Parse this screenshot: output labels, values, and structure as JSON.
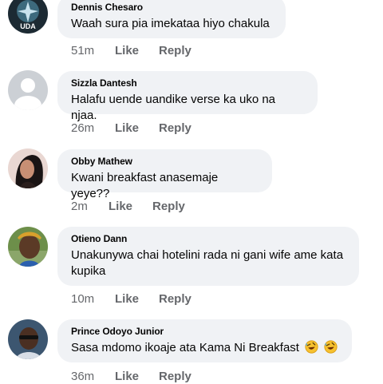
{
  "comments": [
    {
      "name": "Dennis Chesaro",
      "text": "Waah sura pia imekataa hiyo chakula",
      "time": "51m",
      "like": "Like",
      "reply": "Reply",
      "avatar_badge": "UDA"
    },
    {
      "name": "Sizzla Dantesh",
      "text": "Halafu uende uandike verse ka uko na njaa.",
      "time": "26m",
      "like": "Like",
      "reply": "Reply"
    },
    {
      "name": "Obby Mathew",
      "text": "Kwani breakfast anasemaje yeye??",
      "time": "2m",
      "like": "Like",
      "reply": "Reply"
    },
    {
      "name": "Otieno Dann",
      "text_line1": "Unakunywa chai hotelini rada ni gani wife ame kata",
      "text_line2": "kupika",
      "time": "10m",
      "like": "Like",
      "reply": "Reply"
    },
    {
      "name": "Prince Odoyo Junior",
      "text": "Sasa mdomo ikoaje ata Kama Ni Breakfast",
      "emoji_icons": [
        "rolling-laughing-face",
        "rolling-laughing-face"
      ],
      "time": "36m",
      "like": "Like",
      "reply": "Reply"
    }
  ],
  "colors": {
    "bubble": "#f0f2f5",
    "meta": "#65676b",
    "text": "#050505"
  }
}
